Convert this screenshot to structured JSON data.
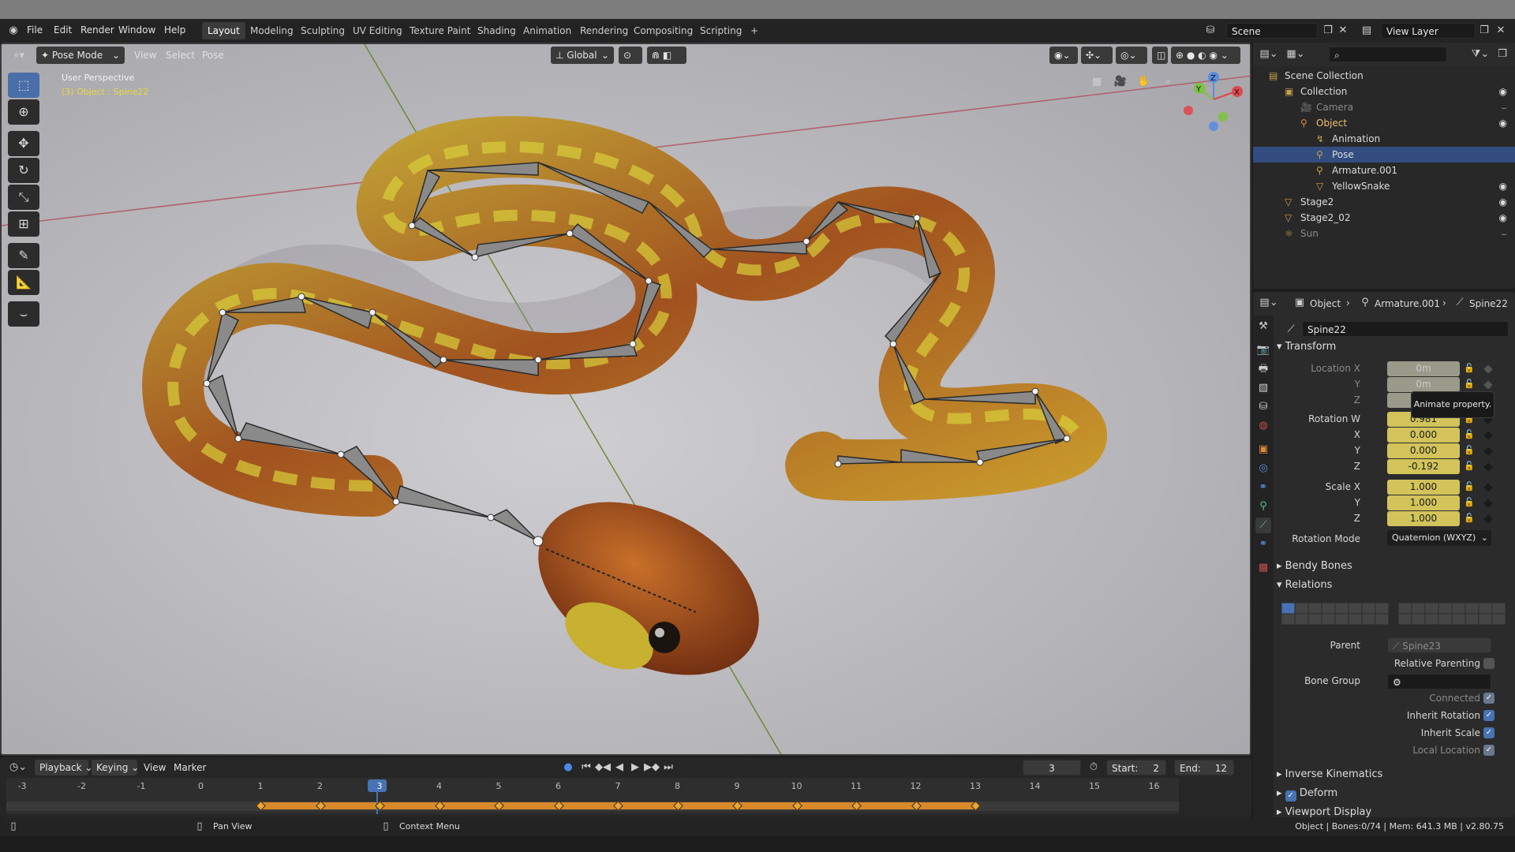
{
  "menubar": {
    "items": [
      "File",
      "Edit",
      "Render",
      "Window",
      "Help"
    ],
    "workspaces": [
      "Layout",
      "Modeling",
      "Sculpting",
      "UV Editing",
      "Texture Paint",
      "Shading",
      "Animation",
      "Rendering",
      "Compositing",
      "Scripting"
    ],
    "active_workspace": "Layout",
    "add_tab": "+",
    "scene": "Scene",
    "view_layer": "View Layer"
  },
  "viewport": {
    "mode": "Pose Mode",
    "menus": [
      "View",
      "Select",
      "Pose"
    ],
    "transform_orientation": "Global",
    "perspective_label": "User Perspective",
    "object_label": "(3) Object : Spine22",
    "gizmo_axes": {
      "z": "Z",
      "y": "Y",
      "x": "X"
    }
  },
  "outliner": {
    "rows": [
      {
        "label": "Scene Collection",
        "icon": "scene-collection-icon",
        "indent": 0,
        "selected": false,
        "dim": false
      },
      {
        "label": "Collection",
        "icon": "collection-icon",
        "indent": 1,
        "selected": false,
        "dim": false
      },
      {
        "label": "Camera",
        "icon": "camera-icon",
        "indent": 2,
        "selected": false,
        "dim": true
      },
      {
        "label": "Object",
        "icon": "armature-object-icon",
        "indent": 2,
        "selected": false,
        "dim": false,
        "highlight": true
      },
      {
        "label": "Animation",
        "icon": "animation-icon",
        "indent": 3,
        "selected": false,
        "dim": false
      },
      {
        "label": "Pose",
        "icon": "pose-icon",
        "indent": 3,
        "selected": true,
        "dim": false
      },
      {
        "label": "Armature.001",
        "icon": "armature-data-icon",
        "indent": 3,
        "selected": false,
        "dim": false
      },
      {
        "label": "YellowSnake",
        "icon": "mesh-object-icon",
        "indent": 3,
        "selected": false,
        "dim": false
      },
      {
        "label": "Stage2",
        "icon": "mesh-object-icon",
        "indent": 1,
        "selected": false,
        "dim": false
      },
      {
        "label": "Stage2_02",
        "icon": "mesh-object-icon",
        "indent": 1,
        "selected": false,
        "dim": false
      },
      {
        "label": "Sun",
        "icon": "light-icon",
        "indent": 1,
        "selected": false,
        "dim": true
      }
    ]
  },
  "properties": {
    "breadcrumb": [
      "Object",
      "Armature.001",
      "Spine22"
    ],
    "bone_name": "Spine22",
    "transform_title": "Transform",
    "location": {
      "label_x": "Location X",
      "label_y": "Y",
      "label_z": "Z",
      "x": "0m",
      "y": "0m",
      "z": "0m"
    },
    "rotation": {
      "label_w": "Rotation W",
      "label_x": "X",
      "label_y": "Y",
      "label_z": "Z",
      "w": "0.981",
      "x": "0.000",
      "y": "0.000",
      "z": "-0.192"
    },
    "scale": {
      "label_x": "Scale X",
      "label_y": "Y",
      "label_z": "Z",
      "x": "1.000",
      "y": "1.000",
      "z": "1.000"
    },
    "rotation_mode_label": "Rotation Mode",
    "rotation_mode": "Quaternion (WXYZ)",
    "bendy_bones": "Bendy Bones",
    "relations": "Relations",
    "parent_label": "Parent",
    "parent_value": "Spine23",
    "relative_parenting": "Relative Parenting",
    "bone_group_label": "Bone Group",
    "connected": "Connected",
    "inherit_rotation": "Inherit Rotation",
    "inherit_scale": "Inherit Scale",
    "local_location": "Local Location",
    "inverse_kinematics": "Inverse Kinematics",
    "deform": "Deform",
    "viewport_display": "Viewport Display",
    "tooltip": "Animate property."
  },
  "timeline": {
    "menus": [
      "Playback",
      "Keying",
      "View",
      "Marker"
    ],
    "current_frame": "3",
    "start_label": "Start:",
    "start": "2",
    "end_label": "End:",
    "end": "12",
    "frames": [
      "-3",
      "-2",
      "-1",
      "0",
      "1",
      "2",
      "3",
      "4",
      "5",
      "6",
      "7",
      "8",
      "9",
      "10",
      "11",
      "12",
      "13",
      "14",
      "15",
      "16"
    ],
    "keyframes": [
      1,
      2,
      3,
      4,
      5,
      6,
      7,
      8,
      9,
      10,
      11,
      12,
      13
    ]
  },
  "statusbar": {
    "pan": "Pan View",
    "context": "Context Menu",
    "info": "Object | Bones:0/74 | Mem: 641.3 MB | v2.80.75"
  },
  "colors": {
    "accent": "#4772b3",
    "keyframe": "#e8a636",
    "animated_field": "#d2c35a",
    "selection": "#334d80"
  }
}
